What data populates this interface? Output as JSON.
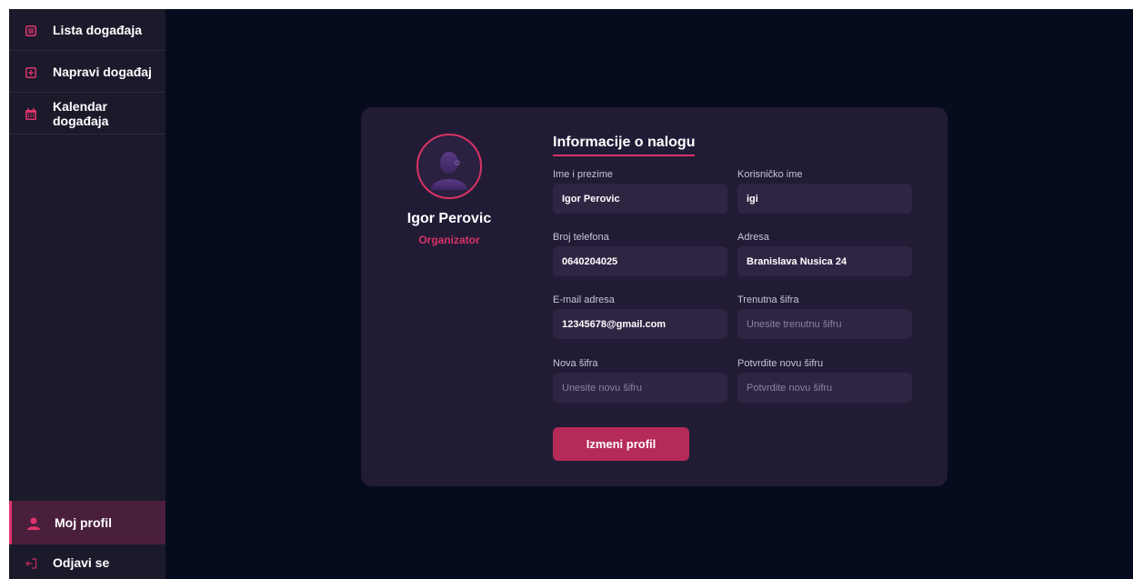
{
  "sidebar": {
    "items": [
      {
        "label": "Lista događaja",
        "icon": "list-icon"
      },
      {
        "label": "Napravi događaj",
        "icon": "add-box-icon"
      },
      {
        "label": "Kalendar događaja",
        "icon": "calendar-icon"
      }
    ],
    "bottom_items": [
      {
        "label": "Moj profil",
        "icon": "user-icon",
        "active": true
      },
      {
        "label": "Odjavi se",
        "icon": "logout-icon"
      }
    ]
  },
  "profile": {
    "name": "Igor Perovic",
    "role": "Organizator"
  },
  "form": {
    "title": "Informacije o nalogu",
    "fields": {
      "full_name": {
        "label": "Ime i prezime",
        "value": "Igor Perovic",
        "placeholder": ""
      },
      "username": {
        "label": "Korisničko ime",
        "value": "igi",
        "placeholder": ""
      },
      "phone": {
        "label": "Broj telefona",
        "value": "0640204025",
        "placeholder": ""
      },
      "address": {
        "label": "Adresa",
        "value": "Branislava Nusica 24",
        "placeholder": ""
      },
      "email": {
        "label": "E-mail adresa",
        "value": "12345678@gmail.com",
        "placeholder": ""
      },
      "current_password": {
        "label": "Trenutna šifra",
        "value": "",
        "placeholder": "Unesite trenutnu šifru"
      },
      "new_password": {
        "label": "Nova šifra",
        "value": "",
        "placeholder": "Unesite novu šifru"
      },
      "confirm_password": {
        "label": "Potvrdite novu šifru",
        "value": "",
        "placeholder": "Potvrdite novu šifru"
      }
    },
    "submit_label": "Izmeni profil"
  },
  "colors": {
    "background": "#070b1e",
    "sidebar": "#1b1a2b",
    "card": "#221b36",
    "input": "#2e2543",
    "accent": "#d73364",
    "button": "#b52b57"
  }
}
